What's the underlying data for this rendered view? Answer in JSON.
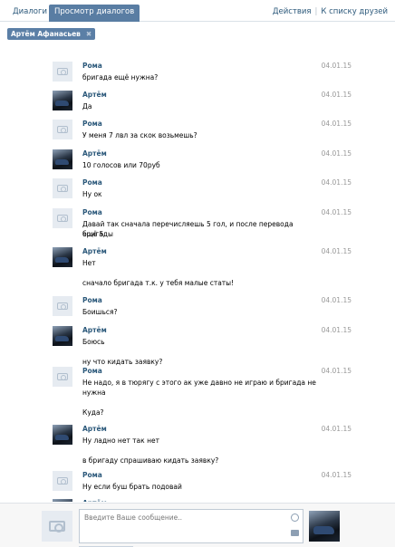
{
  "tabs": {
    "dialogs": "Диалоги",
    "view_dialogs": "Просмотр диалогов"
  },
  "actions": {
    "actions_label": "Действия",
    "separator": "|",
    "friends_label": "К списку друзей"
  },
  "filter_chip": {
    "label": "Артём Афанасьев",
    "close": "✖"
  },
  "messages": [
    {
      "author": "Рома",
      "date": "04.01.15",
      "avatar": "camera-placeholder",
      "lines": [
        "бригада ещё нужна?"
      ]
    },
    {
      "author": "Артём",
      "date": "04.01.15",
      "avatar": "car-photo",
      "lines": [
        "Да"
      ]
    },
    {
      "author": "Рома",
      "date": "04.01.15",
      "avatar": "camera-placeholder",
      "lines": [
        "У меня 7 лвл за скок возьмешь?"
      ]
    },
    {
      "author": "Артём",
      "date": "04.01.15",
      "avatar": "car-photo",
      "lines": [
        "10 голосов или 70руб"
      ]
    },
    {
      "author": "Рома",
      "date": "04.01.15",
      "avatar": "camera-placeholder",
      "lines": [
        "Ну ок"
      ]
    },
    {
      "author": "Рома",
      "date": "04.01.15",
      "avatar": "camera-placeholder",
      "lines": [
        "Давай так сначала перечисляешь 5 гол, и после перевода бригады",
        "ещё 5"
      ]
    },
    {
      "author": "Артём",
      "date": "04.01.15",
      "avatar": "car-photo",
      "lines": [
        "Нет",
        "",
        "сначало бригада т.к. у тебя малые статы!"
      ]
    },
    {
      "author": "Рома",
      "date": "04.01.15",
      "avatar": "camera-placeholder",
      "lines": [
        "Боишься?"
      ]
    },
    {
      "author": "Артём",
      "date": "04.01.15",
      "avatar": "car-photo",
      "lines": [
        "Боюсь",
        "",
        "ну что кидать заявку?"
      ]
    },
    {
      "author": "Рома",
      "date": "04.01.15",
      "avatar": "camera-placeholder",
      "lines": [
        "Не надо, я в тюрягу с этого ак уже давно не играю и бригада не",
        "нужна",
        "",
        "Куда?"
      ]
    },
    {
      "author": "Артём",
      "date": "04.01.15",
      "avatar": "car-photo",
      "lines": [
        "Ну ладно нет так нет",
        "",
        "в бригаду спрашиваю кидать заявку?"
      ]
    },
    {
      "author": "Рома",
      "date": "04.01.15",
      "avatar": "camera-placeholder",
      "lines": [
        "Ну если буш брать подовай"
      ]
    },
    {
      "author": "Артём",
      "date": "",
      "avatar": "car-photo",
      "lines": []
    }
  ],
  "composer": {
    "placeholder": "Введите Ваше сообщение..",
    "smile_icon": "smile-icon",
    "attach_icon": "attach-icon"
  }
}
